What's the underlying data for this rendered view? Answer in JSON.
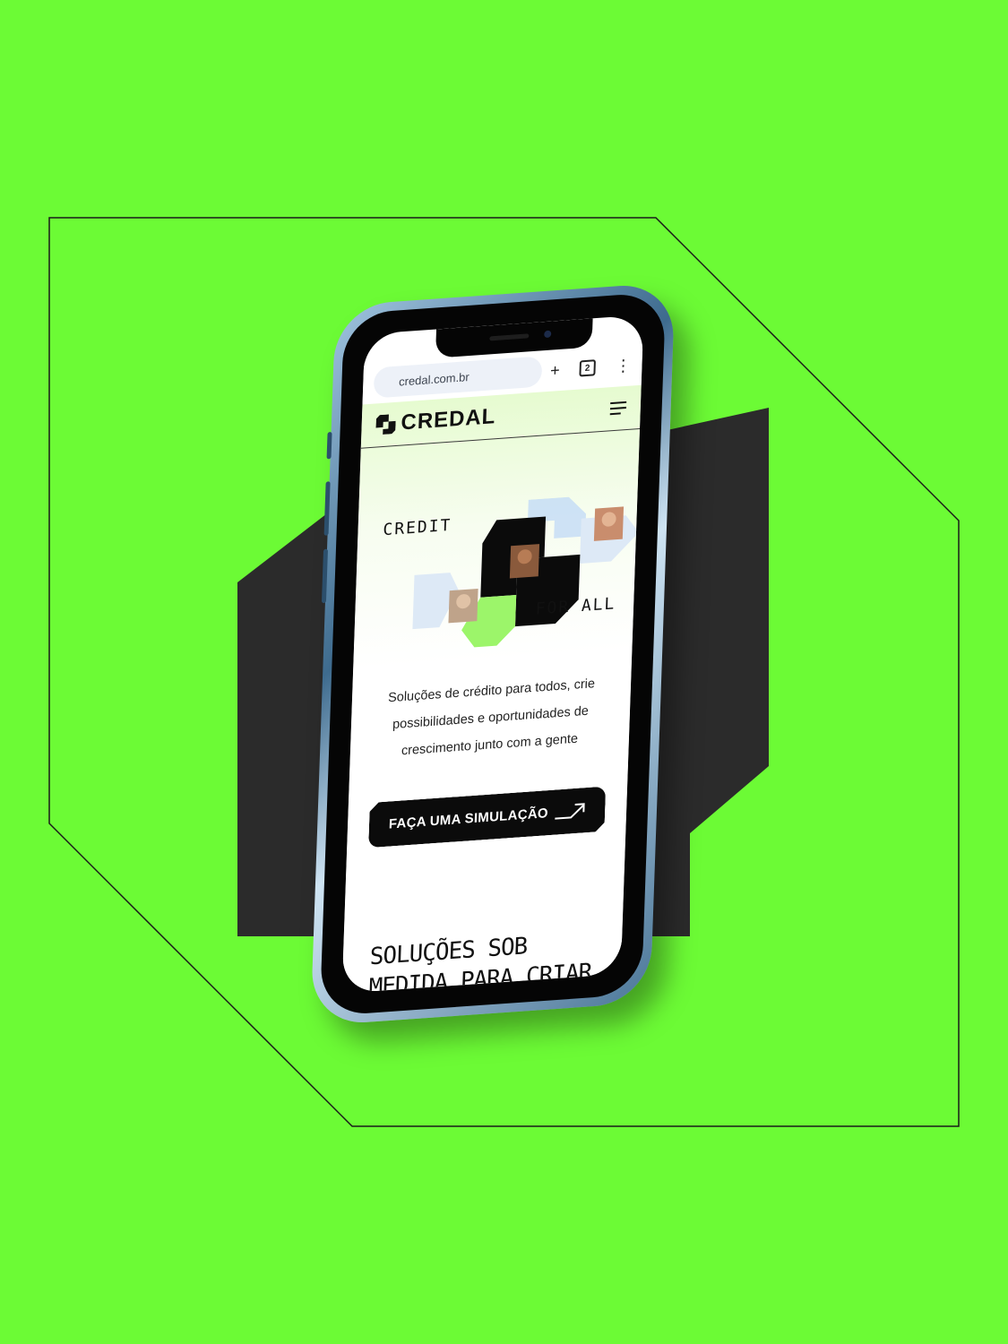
{
  "browser": {
    "url": "credal.com.br",
    "tab_count": "2"
  },
  "site": {
    "brand": "CREDAL",
    "hero": {
      "word1": "CREDIT",
      "word2": "FOR ALL"
    },
    "description": [
      "Soluções de crédito para todos, crie",
      "possibilidades e oportunidades de",
      "crescimento junto com a gente"
    ],
    "cta_label": "FAÇA UMA SIMULAÇÃO",
    "section_title_line1": "SOLUÇÕES SOB",
    "section_title_line2": "MEDIDA PARA CRIAR"
  },
  "icons": {
    "new_tab": "plus-icon",
    "tabs": "tab-switcher-icon",
    "more": "kebab-menu-icon",
    "menu": "hamburger-menu-icon",
    "cta_arrow": "arrow-up-right-icon"
  },
  "colors": {
    "background": "#6cfb35",
    "dark_block": "#2b2b2b",
    "brand_dark": "#0b0b0b",
    "accent_green": "#9cf56a",
    "accent_blue": "#c9dff5"
  }
}
